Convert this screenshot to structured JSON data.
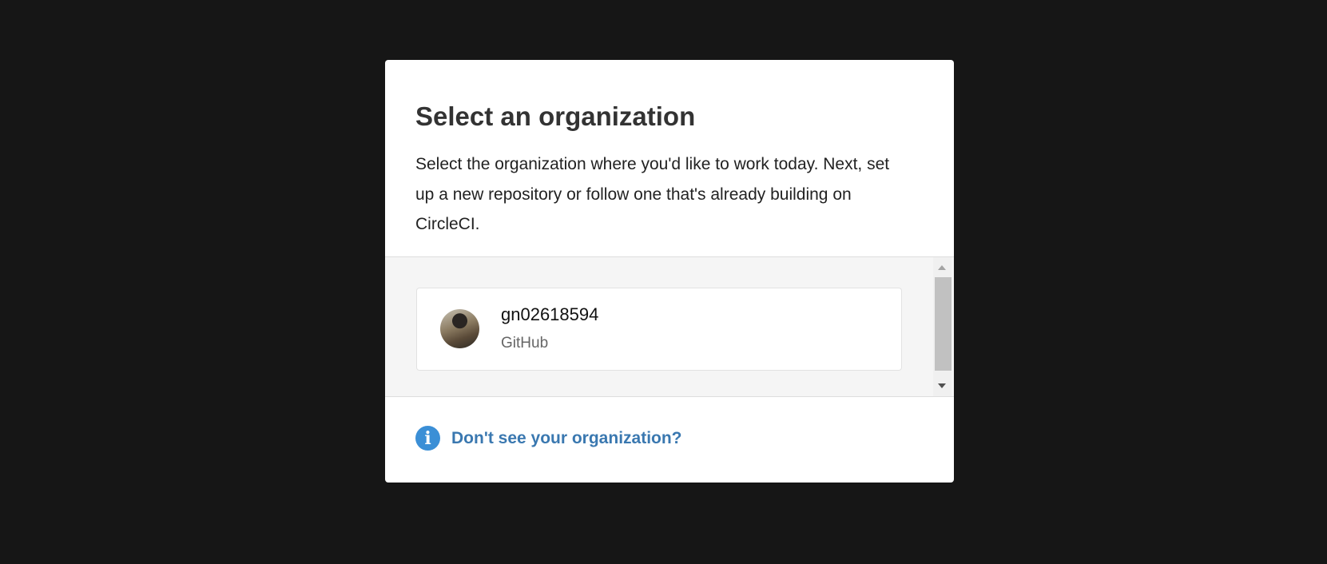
{
  "modal": {
    "title": "Select an organization",
    "description": "Select the organization where you'd like to work today. Next, set up a new repository or follow one that's already building on CircleCI.",
    "organizations": [
      {
        "name": "gn02618594",
        "provider": "GitHub"
      }
    ],
    "help_link": "Don't see your organization?",
    "help_icon": "i"
  }
}
